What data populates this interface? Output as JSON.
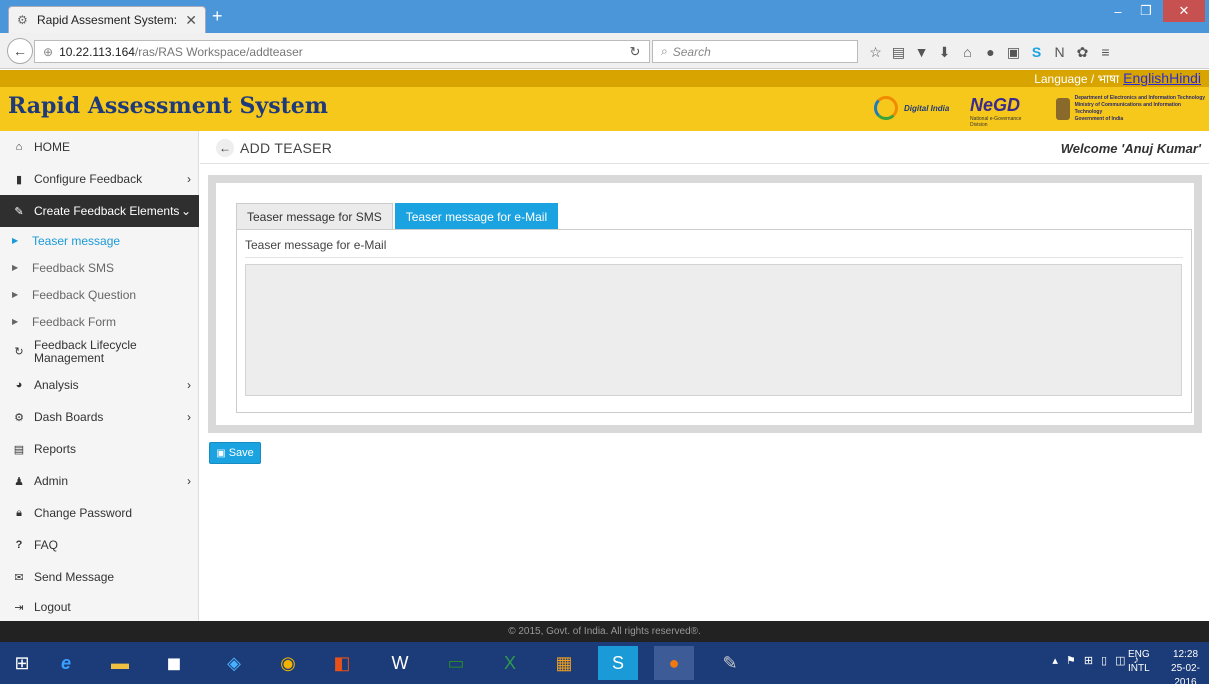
{
  "browser": {
    "tab_title": "Rapid Assesment System: ...",
    "tab_close": "✕",
    "new_tab": "+",
    "url_host": "10.22.113.164",
    "url_path": "/ras/RAS Workspace/addteaser",
    "search_placeholder": "Search"
  },
  "site": {
    "language_label": "Language / भाषा",
    "lang_english": "English",
    "lang_hindi": "Hindi",
    "title": "Rapid Assessment System",
    "logo_digital_india": "Digital India",
    "logo_negd": "NeGD",
    "logo_negd_sub": "National e-Governance Division",
    "logo_deity_1": "Department of Electronics and Information Technology",
    "logo_deity_2": "Ministry of Communications and Information Technology",
    "logo_deity_3": "Government of India"
  },
  "sidebar": {
    "home": "HOME",
    "configure_feedback": "Configure Feedback",
    "create_feedback_elements": "Create Feedback Elements",
    "sub_teaser": "Teaser message",
    "sub_sms": "Feedback SMS",
    "sub_question": "Feedback Question",
    "sub_form": "Feedback Form",
    "lifecycle": "Feedback Lifecycle Management",
    "analysis": "Analysis",
    "dashboards": "Dash Boards",
    "reports": "Reports",
    "admin": "Admin",
    "change_password": "Change Password",
    "faq": "FAQ",
    "send_message": "Send Message",
    "logout": "Logout"
  },
  "page": {
    "title": "ADD TEASER",
    "welcome": "Welcome 'Anuj Kumar'",
    "tab_sms": "Teaser message for SMS",
    "tab_email": "Teaser message for e-Mail",
    "section_label": "Teaser message for e-Mail",
    "textarea_value": "",
    "save_label": "Save"
  },
  "footer": {
    "text": "© 2015, Govt. of India. All rights reserved®."
  },
  "taskbar": {
    "lang_top": "ENG",
    "lang_bottom": "INTL",
    "time": "12:28",
    "date": "25-02-2016"
  },
  "colors": {
    "header_yellow": "#f7c81c",
    "lang_bar": "#d8a400",
    "accent_blue": "#1aa3e0",
    "sidebar_active": "#2f2f2f",
    "title_navy": "#1e3a7a"
  }
}
